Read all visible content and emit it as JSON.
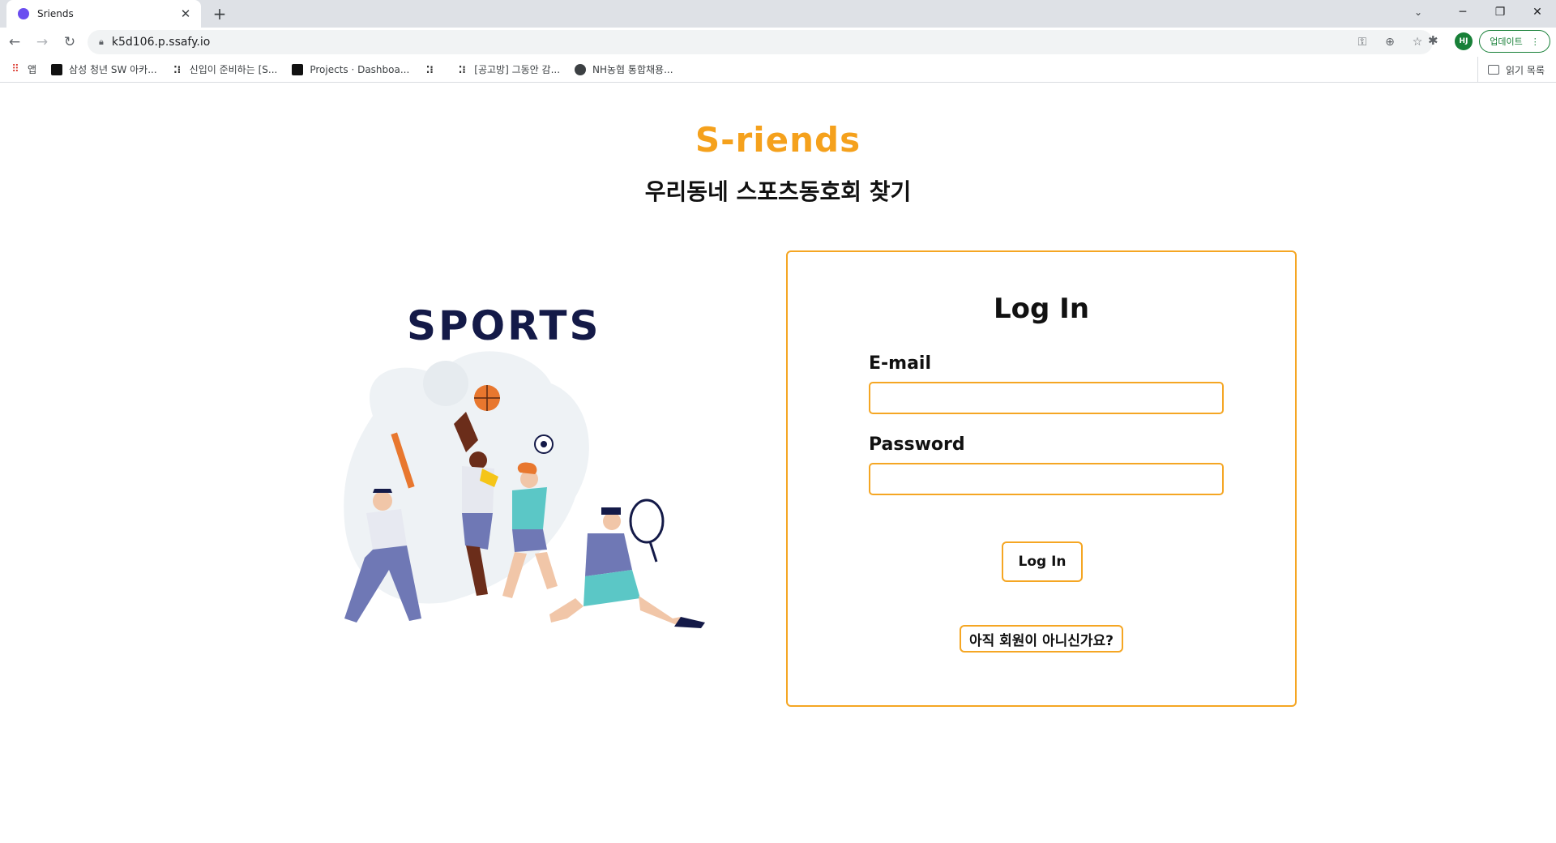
{
  "browser": {
    "tab_title": "Sriends",
    "url": "k5d106.p.ssafy.io",
    "update_label": "업데이트",
    "avatar_initials": "HJ",
    "bookmarks": [
      {
        "label": "앱",
        "icon": "apps-grid-icon"
      },
      {
        "label": "삼성 청년 SW 아카...",
        "icon": "bookmark-dark-icon"
      },
      {
        "label": "신입이 준비하는 [S...",
        "icon": "bookmark-dots-icon"
      },
      {
        "label": "Projects · Dashboa...",
        "icon": "bookmark-dark-icon"
      },
      {
        "label": "",
        "icon": "bookmark-dots-icon"
      },
      {
        "label": "[공고방] 그동안 감...",
        "icon": "bookmark-dots-icon"
      },
      {
        "label": "NH농협 통합채용...",
        "icon": "globe-icon"
      }
    ],
    "reading_list_label": "읽기 목록"
  },
  "page": {
    "brand": "S-riends",
    "subtitle": "우리동네 스포츠동호회 찾기",
    "illustration_text": "SPORTS",
    "login": {
      "title": "Log In",
      "email_label": "E-mail",
      "email_value": "",
      "password_label": "Password",
      "password_value": "",
      "submit_label": "Log In",
      "signup_label": "아직 회원이 아니신가요?"
    }
  },
  "colors": {
    "accent": "#f5a623",
    "brand": "#f5a11c",
    "illustration_navy": "#141a48"
  }
}
